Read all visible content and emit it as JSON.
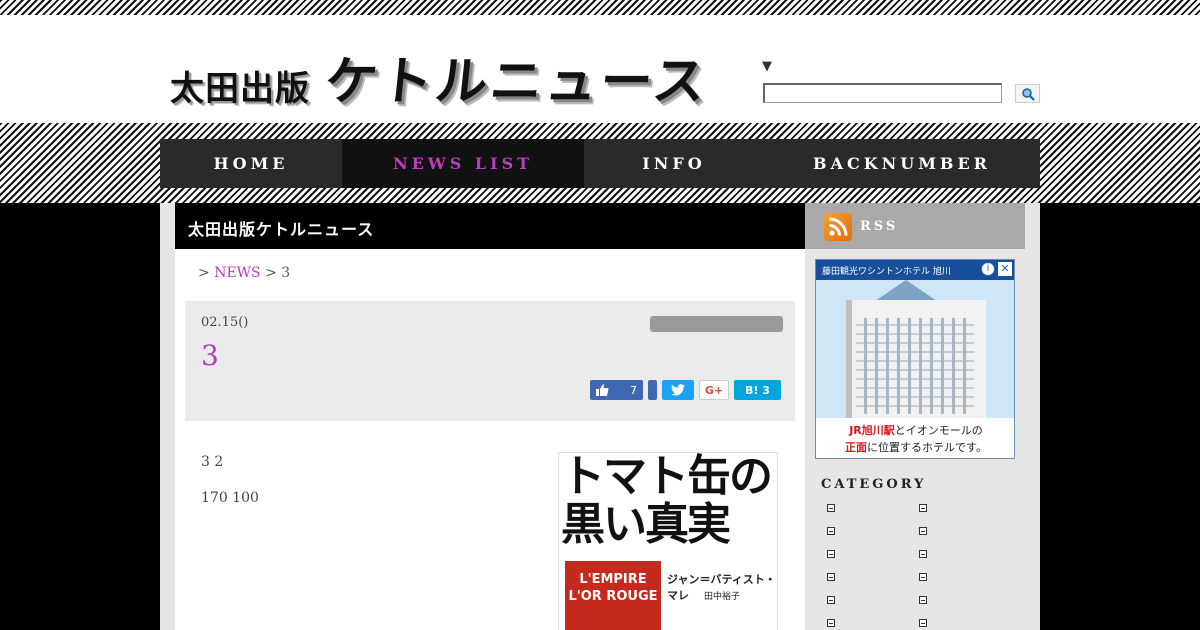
{
  "header": {
    "logo_small": "太田出版",
    "logo_big": "ケトルニュース",
    "search_toggle": "▼",
    "search_placeholder": "",
    "search_icon": "search-icon"
  },
  "nav": {
    "items": [
      {
        "label": "HOME",
        "active": false
      },
      {
        "label": "NEWS LIST",
        "active": true
      },
      {
        "label": "INFO",
        "active": false
      },
      {
        "label": "BACKNUMBER",
        "active": false
      }
    ]
  },
  "main": {
    "section_title": "太田出版ケトルニュース",
    "breadcrumb": {
      "sep1": ">",
      "link": "NEWS",
      "sep2": ">",
      "current": "3"
    },
    "entry": {
      "date": "02.15()",
      "title": "3",
      "share": {
        "fb_like_count": "7",
        "twitter_icon": "twitter-icon",
        "gplus_label": "G+",
        "hatena_label": "B!",
        "hatena_count": "3"
      }
    },
    "paragraphs": [
      "3 2",
      "170 100"
    ],
    "book": {
      "title_line1": "トマト缶の",
      "title_line2": "黒い真実",
      "can_line1": "L'EMPIRE",
      "can_line2": "L'OR ROUGE",
      "author": "ジャン＝バティスト・マレ",
      "translator": "田中裕子"
    }
  },
  "sidebar": {
    "rss_label": "RSS",
    "ad": {
      "hotel_name": "藤田観光ワシントンホテル 旭川",
      "line1_red": "JR旭川駅",
      "line1_rest": "とイオンモールの",
      "line2_red": "正面",
      "line2_rest": "に位置するホテルです。",
      "close_icon": "close-icon",
      "info_icon": "info-icon"
    },
    "category_title": "CATEGORY",
    "categories": [
      "",
      "",
      "",
      "",
      "",
      "",
      "",
      "",
      "",
      "",
      "",
      ""
    ]
  },
  "colors": {
    "accent": "#b13cc0",
    "nav_bg": "#2a2a2a",
    "sidebar_bg": "#e6e6e6",
    "rss_bar": "#a9a9a9"
  }
}
